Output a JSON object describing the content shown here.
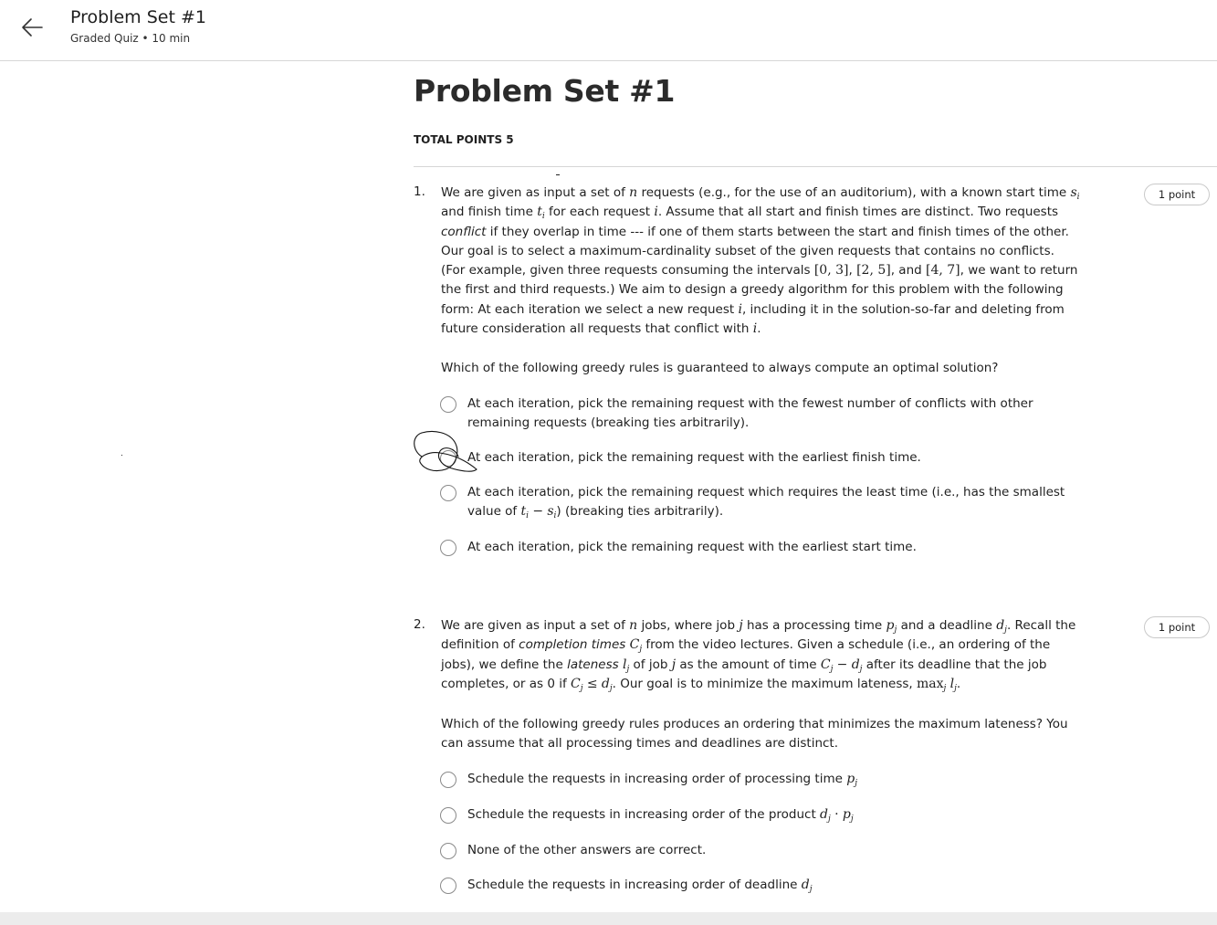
{
  "header": {
    "title": "Problem Set #1",
    "subtitle": "Graded Quiz • 10 min"
  },
  "main": {
    "title": "Problem Set #1",
    "total_points": "TOTAL POINTS 5"
  },
  "questions": [
    {
      "number": "1.",
      "points": "1 point",
      "prompt": "Which of the following greedy rules is guaranteed to always compute an optimal solution?",
      "options": [
        "At each iteration, pick the remaining request with the fewest number of conflicts with other remaining requests (breaking ties arbitrarily).",
        "At each iteration, pick the remaining request with the earliest finish time.",
        "At each iteration, pick the remaining request which requires the least time (i.e., has the smallest value of t_i − s_i) (breaking ties arbitrarily).",
        "At each iteration, pick the remaining request with the earliest start time."
      ]
    },
    {
      "number": "2.",
      "points": "1 point",
      "prompt": "Which of the following greedy rules produces an ordering that minimizes the maximum lateness? You can assume that all processing times and deadlines are distinct.",
      "options": [
        "Schedule the requests in increasing order of processing time p_j",
        "Schedule the requests in increasing order of the product d_j · p_j",
        "None of the other answers are correct.",
        "Schedule the requests in increasing order of deadline d_j"
      ]
    }
  ]
}
